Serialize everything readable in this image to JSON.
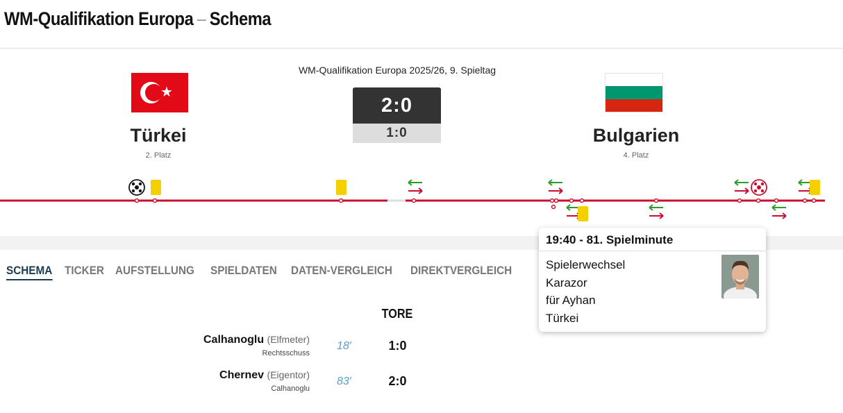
{
  "header": {
    "title_main": "WM-Qualifikation Europa",
    "separator": "–",
    "title_sub": "Schema"
  },
  "match": {
    "competition": "WM-Qualifikation Europa 2025/26, 9. Spieltag",
    "home": {
      "name": "Türkei",
      "rank": "2. Platz"
    },
    "away": {
      "name": "Bulgarien",
      "rank": "4. Platz"
    },
    "score": "2:0",
    "halftime": "1:0"
  },
  "colors": {
    "accent": "#1a3b52",
    "timeline_red": "#c8102e",
    "sub_in": "#2a9d2a",
    "sub_out": "#c8102e",
    "yellow_card": "#f5d000",
    "minute_blue": "#5b9ec9"
  },
  "tabs": [
    {
      "label": "SCHEMA",
      "active": true
    },
    {
      "label": "TICKER",
      "active": false
    },
    {
      "label": "AUFSTELLUNG",
      "active": false
    },
    {
      "label": "SPIELDATEN",
      "active": false
    },
    {
      "label": "DATEN-VERGLEICH",
      "active": false
    },
    {
      "label": "DIREKTVERGLEICH",
      "active": false
    }
  ],
  "goals": {
    "heading": "TORE",
    "rows": [
      {
        "player": "Calhanoglu",
        "kind": "(Elfmeter)",
        "detail": "Rechtsschuss",
        "minute": "18′",
        "score": "1:0"
      },
      {
        "player": "Chernev",
        "kind": "(Eigentor)",
        "detail": "Calhanoglu",
        "minute": "83′",
        "score": "2:0"
      }
    ]
  },
  "tooltip": {
    "title": "19:40 - 81. Spielminute",
    "lines": [
      "Spielerwechsel",
      "Karazor",
      "für Ayhan",
      "Türkei"
    ]
  }
}
